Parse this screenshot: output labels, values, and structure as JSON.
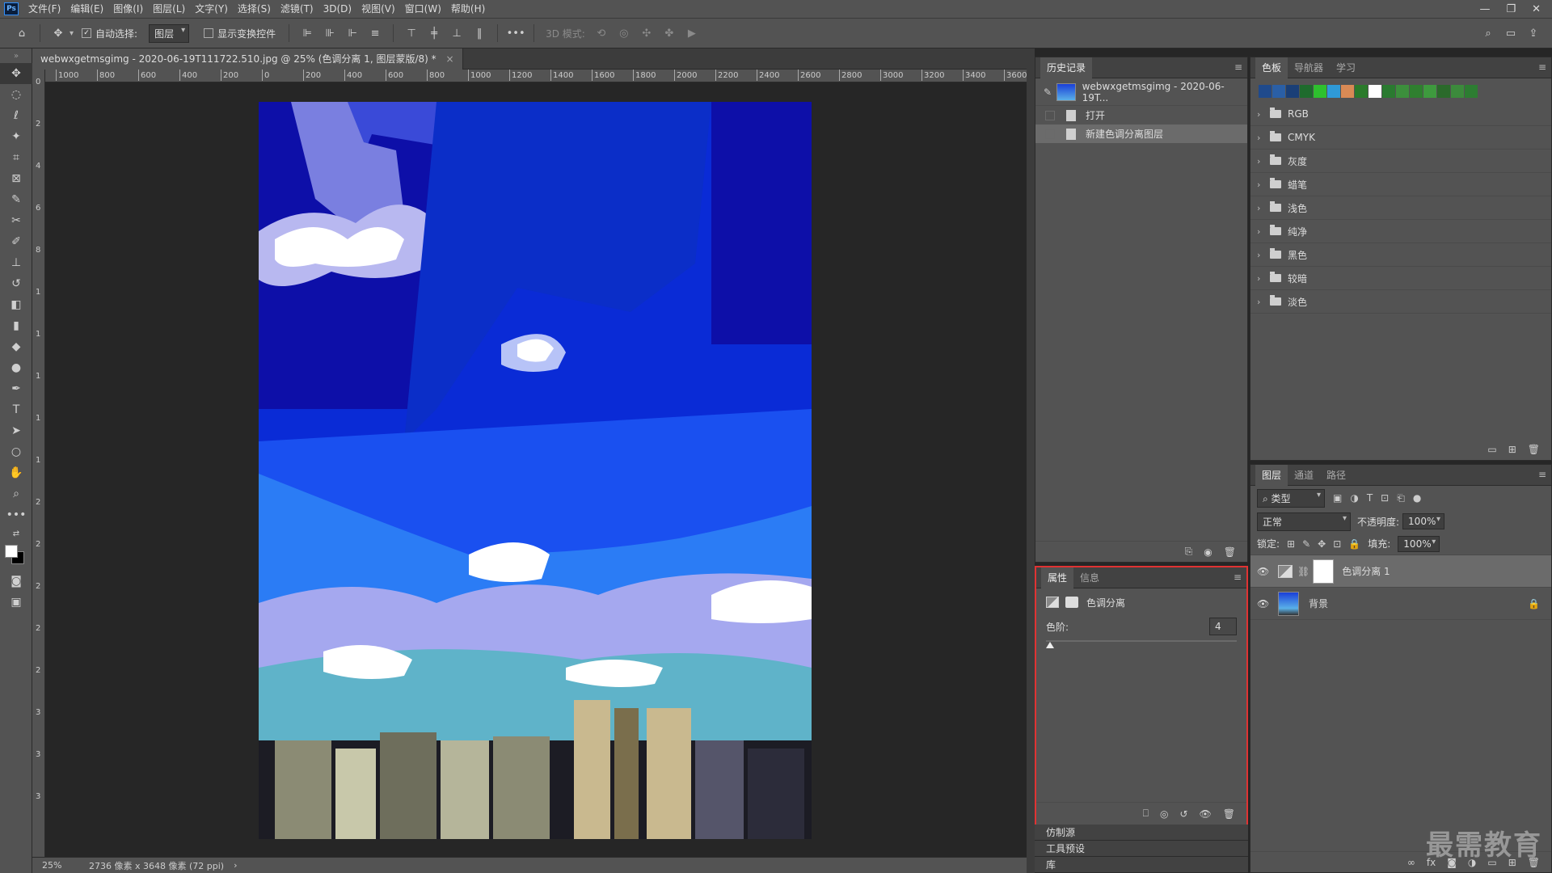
{
  "app": {
    "logo": "Ps"
  },
  "menu": [
    "文件(F)",
    "编辑(E)",
    "图像(I)",
    "图层(L)",
    "文字(Y)",
    "选择(S)",
    "滤镜(T)",
    "3D(D)",
    "视图(V)",
    "窗口(W)",
    "帮助(H)"
  ],
  "window_controls": {
    "minimize": "—",
    "restore": "❐",
    "close": "✕"
  },
  "options": {
    "auto_select_label": "自动选择:",
    "auto_select_value": "图层",
    "show_transform_label": "显示变换控件",
    "mode_3d_label": "3D 模式:",
    "more": "•••"
  },
  "document": {
    "tab_title": "webwxgetmsgimg - 2020-06-19T111722.510.jpg @ 25% (色调分离 1, 图层蒙版/8) *",
    "tab_close": "×"
  },
  "ruler_top_labels": [
    "1000",
    "800",
    "600",
    "400",
    "200",
    "0",
    "200",
    "400",
    "600",
    "800",
    "1000",
    "1200",
    "1400",
    "1600",
    "1800",
    "2000",
    "2200",
    "2400",
    "2600",
    "2800",
    "3000",
    "3200",
    "3400",
    "3600"
  ],
  "ruler_left_labels": [
    "0",
    "2",
    "4",
    "6",
    "8",
    "1",
    "1",
    "1",
    "1",
    "1",
    "2",
    "2",
    "2",
    "2",
    "2",
    "3",
    "3",
    "3"
  ],
  "status": {
    "zoom": "25%",
    "doc_info": "2736 像素 x 3648 像素 (72 ppi)",
    "arrow": "›"
  },
  "history": {
    "tab": "历史记录",
    "snapshot": "webwxgetmsgimg - 2020-06-19T...",
    "items": [
      "打开",
      "新建色调分离图层"
    ]
  },
  "properties": {
    "tabs": [
      "属性",
      "信息"
    ],
    "title": "色调分离",
    "levels_label": "色阶:",
    "levels_value": "4",
    "levels_fraction": 0.0
  },
  "collapsed_panels": [
    "仿制源",
    "工具预设",
    "库"
  ],
  "swatches": {
    "tabs": [
      "色板",
      "导航器",
      "学习"
    ],
    "colors": [
      "#1f4a8c",
      "#2a5fa6",
      "#1a3f77",
      "#1e6b2d",
      "#2ec02e",
      "#2f9ad8",
      "#d98a55",
      "#2b7a2b",
      "#ffffff",
      "#2a7a30",
      "#3c8f3c",
      "#2f7f2f",
      "#3e9a3e",
      "#2b6a2b",
      "#3c8a3c",
      "#2d7d32"
    ],
    "groups": [
      "RGB",
      "CMYK",
      "灰度",
      "蜡笔",
      "浅色",
      "纯净",
      "黑色",
      "较暗",
      "淡色"
    ]
  },
  "layers": {
    "tabs": [
      "图层",
      "通道",
      "路径"
    ],
    "filter_label": "类型",
    "blend_mode": "正常",
    "opacity_label": "不透明度:",
    "opacity_value": "100%",
    "lock_label": "锁定:",
    "fill_label": "填充:",
    "fill_value": "100%",
    "items": [
      {
        "name": "色调分离 1"
      },
      {
        "name": "背景"
      }
    ],
    "bottom_icons": [
      "link-icon",
      "fx",
      "mask-icon",
      "adjust-icon",
      "folder-icon",
      "new-icon",
      "trash-icon"
    ]
  },
  "watermark": "最需教育"
}
